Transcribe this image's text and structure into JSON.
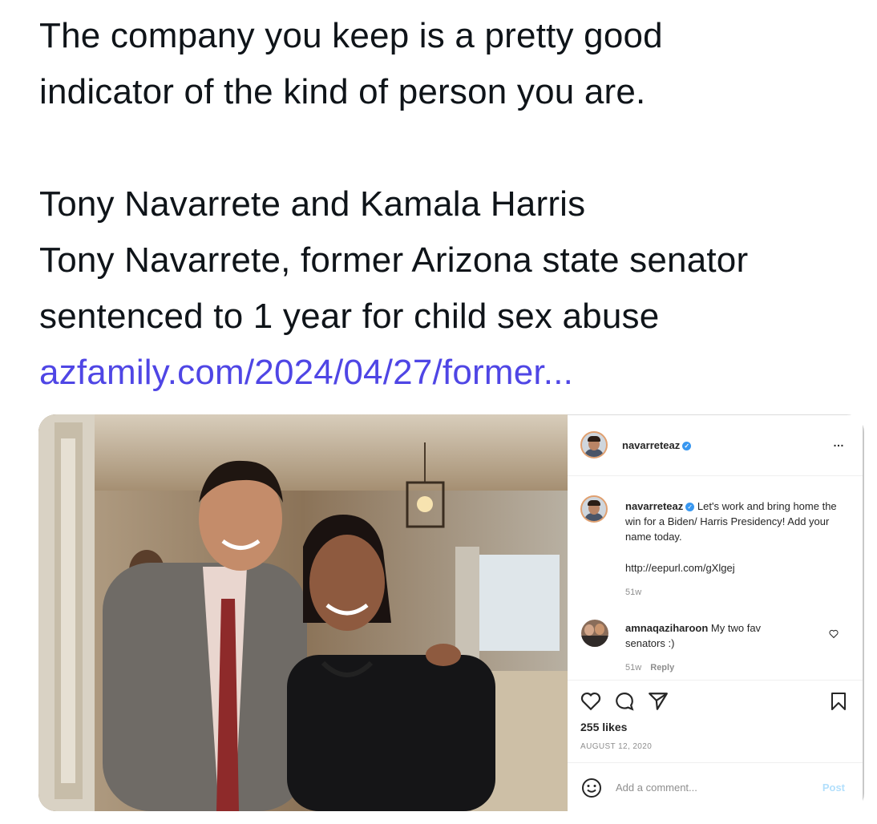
{
  "post": {
    "line1": "The company you keep is a pretty good",
    "line2": "indicator of the kind of person you are.",
    "line3": "Tony Navarrete and Kamala Harris",
    "line4": "Tony Navarrete, former Arizona state senator",
    "line5": "sentenced to 1 year for child sex abuse",
    "link": "azfamily.com/2024/04/27/former..."
  },
  "instagram": {
    "username": "navarreteaz",
    "more": "…",
    "caption_username": "navarreteaz",
    "caption_text": "Let's work and bring home the win for a Biden/ Harris Presidency! Add your name today.",
    "caption_url": "http://eepurl.com/gXlgej",
    "caption_age": "51w",
    "comment_username": "amnaqaziharoon",
    "comment_text": "My two fav senators :)",
    "comment_age": "51w",
    "comment_reply": "Reply",
    "likes": "255 likes",
    "date": "AUGUST 12, 2020",
    "add_comment_placeholder": "Add a comment...",
    "post_button": "Post"
  },
  "icons": [
    "verified-badge-icon",
    "more-icon",
    "heart-icon",
    "comment-icon",
    "share-icon",
    "bookmark-icon",
    "emoji-icon"
  ],
  "colors": {
    "link": "#4f46e5",
    "text": "#0f1419",
    "verified": "#3897f0",
    "muted": "#8e8e8e",
    "post_button": "#b2dffc"
  }
}
